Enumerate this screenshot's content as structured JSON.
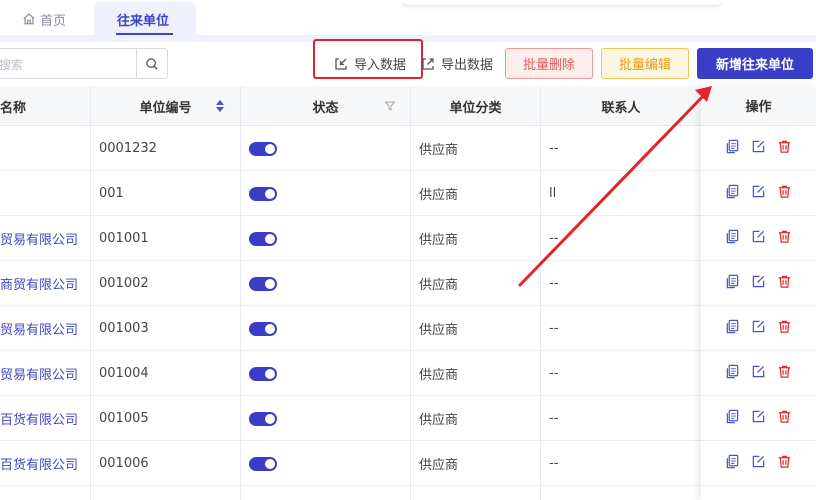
{
  "tabs": {
    "home": "首页",
    "active": "往来单位"
  },
  "search": {
    "placeholder": "搜索"
  },
  "toolbar": {
    "import_label": "导入数据",
    "export_label": "导出数据",
    "batch_delete_label": "批量删除",
    "batch_edit_label": "批量编辑",
    "add_label": "新增往来单位"
  },
  "table": {
    "headers": {
      "name": "名称",
      "code": "单位编号",
      "status": "状态",
      "category": "单位分类",
      "contact": "联系人",
      "ops": "操作"
    },
    "rows": [
      {
        "name": "",
        "code": "0001232",
        "category": "供应商",
        "contact": "--"
      },
      {
        "name": "",
        "code": "001",
        "category": "供应商",
        "contact": "ll"
      },
      {
        "name": "贸易有限公司",
        "code": "001001",
        "category": "供应商",
        "contact": "--"
      },
      {
        "name": "商贸有限公司",
        "code": "001002",
        "category": "供应商",
        "contact": "--"
      },
      {
        "name": "贸易有限公司",
        "code": "001003",
        "category": "供应商",
        "contact": "--"
      },
      {
        "name": "贸易有限公司",
        "code": "001004",
        "category": "供应商",
        "contact": "--"
      },
      {
        "name": "百货有限公司",
        "code": "001005",
        "category": "供应商",
        "contact": "--"
      },
      {
        "name": "百货有限公司",
        "code": "001006",
        "category": "供应商",
        "contact": "--"
      }
    ]
  },
  "colors": {
    "primary": "#3a3ec6",
    "danger": "#e0262b",
    "warning": "#e89b10"
  }
}
